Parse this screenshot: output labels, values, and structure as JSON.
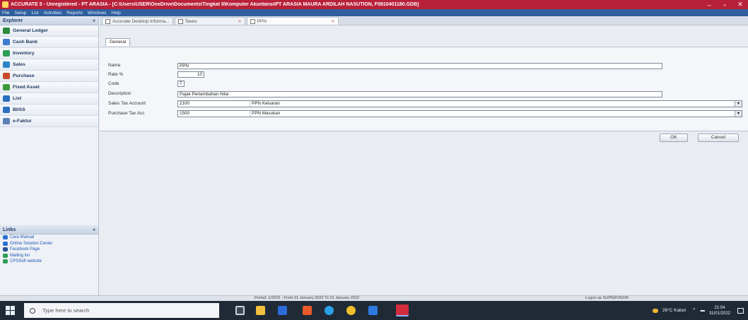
{
  "window": {
    "title": "ACCURATE 5 - Unregistered - PT ARASIA - [C:\\Users\\USER\\OneDrive\\Documents\\Tingkat II\\Komputer Akuntansi\\PT ARASIA MAURA ARDILAH NASUTION, F0810401180.GDB]",
    "controls": [
      "–",
      "▫",
      "✕"
    ]
  },
  "menubar": {
    "items": [
      "File",
      "Setup",
      "List",
      "Activities",
      "Reports",
      "Windows",
      "Help"
    ]
  },
  "sidebar": {
    "explorer_title": "Explorer",
    "collapse": "«",
    "items": [
      {
        "label": "General Ledger",
        "icon": "general-ledger-icon",
        "color": "#2d8a3c"
      },
      {
        "label": "Cash Bank",
        "icon": "cash-bank-icon",
        "color": "#3d7bd1"
      },
      {
        "label": "Inventory",
        "icon": "inventory-icon",
        "color": "#2d9d54"
      },
      {
        "label": "Sales",
        "icon": "sales-icon",
        "color": "#2a86c9"
      },
      {
        "label": "Purchase",
        "icon": "purchase-icon",
        "color": "#c94a2e"
      },
      {
        "label": "Fixed Asset",
        "icon": "fixed-asset-icon",
        "color": "#3c9a3a"
      },
      {
        "label": "List",
        "icon": "list-icon",
        "color": "#2b6fc0"
      },
      {
        "label": "BI/SS",
        "icon": "biss-icon",
        "color": "#2b6fc0"
      },
      {
        "label": "e-Faktur",
        "icon": "efaktur-icon",
        "color": "#5a7fb5"
      }
    ],
    "links_title": "Links",
    "links_collapse": "«",
    "links": [
      {
        "label": "Cara Manual",
        "icon": "manual-icon",
        "color": "#2a6fd1"
      },
      {
        "label": "Online Solution Center",
        "icon": "solution-center-icon",
        "color": "#2a6fd1"
      },
      {
        "label": "Facebook Page",
        "icon": "facebook-icon",
        "color": "#2c4f9a"
      },
      {
        "label": "Mailing list",
        "icon": "mailing-list-icon",
        "color": "#2d9d54"
      },
      {
        "label": "CPSSoft website",
        "icon": "website-icon",
        "color": "#2d9d54"
      }
    ]
  },
  "tabs": [
    {
      "label": "Accurate Desktop Informa...",
      "close": "✕"
    },
    {
      "label": "Taxes",
      "close": "✕"
    },
    {
      "label": "PPN",
      "close": "✕"
    }
  ],
  "form": {
    "inner_tab": "General",
    "name_label": "Name",
    "name_value": "PPN",
    "rate_label": "Rate %",
    "rate_value": "10",
    "code_label": "Code",
    "code_value": "T",
    "description_label": "Description",
    "description_value": "Pajak Pertambahan Nilai",
    "sales_account_label": "Sales Tax Account",
    "sales_account_code": "2100",
    "sales_account_name": "PPN Keluaran",
    "purchase_account_label": "Purchase Tax Acc",
    "purchase_account_code": "1500",
    "purchase_account_name": "PPN Masukan",
    "combo_arrow": "▼",
    "ok_button": "OK",
    "cancel_button": "Cancel"
  },
  "statusbar": {
    "period": "Period: 1/2022 - From 01 January 2022 To 31 January 2022",
    "login": "Logon as SUPERVISOR"
  },
  "taskbar": {
    "search_placeholder": "Type here to search",
    "weather": "26°C Kabut",
    "chevron": "^",
    "time": "21:04",
    "date": "31/01/2022"
  }
}
